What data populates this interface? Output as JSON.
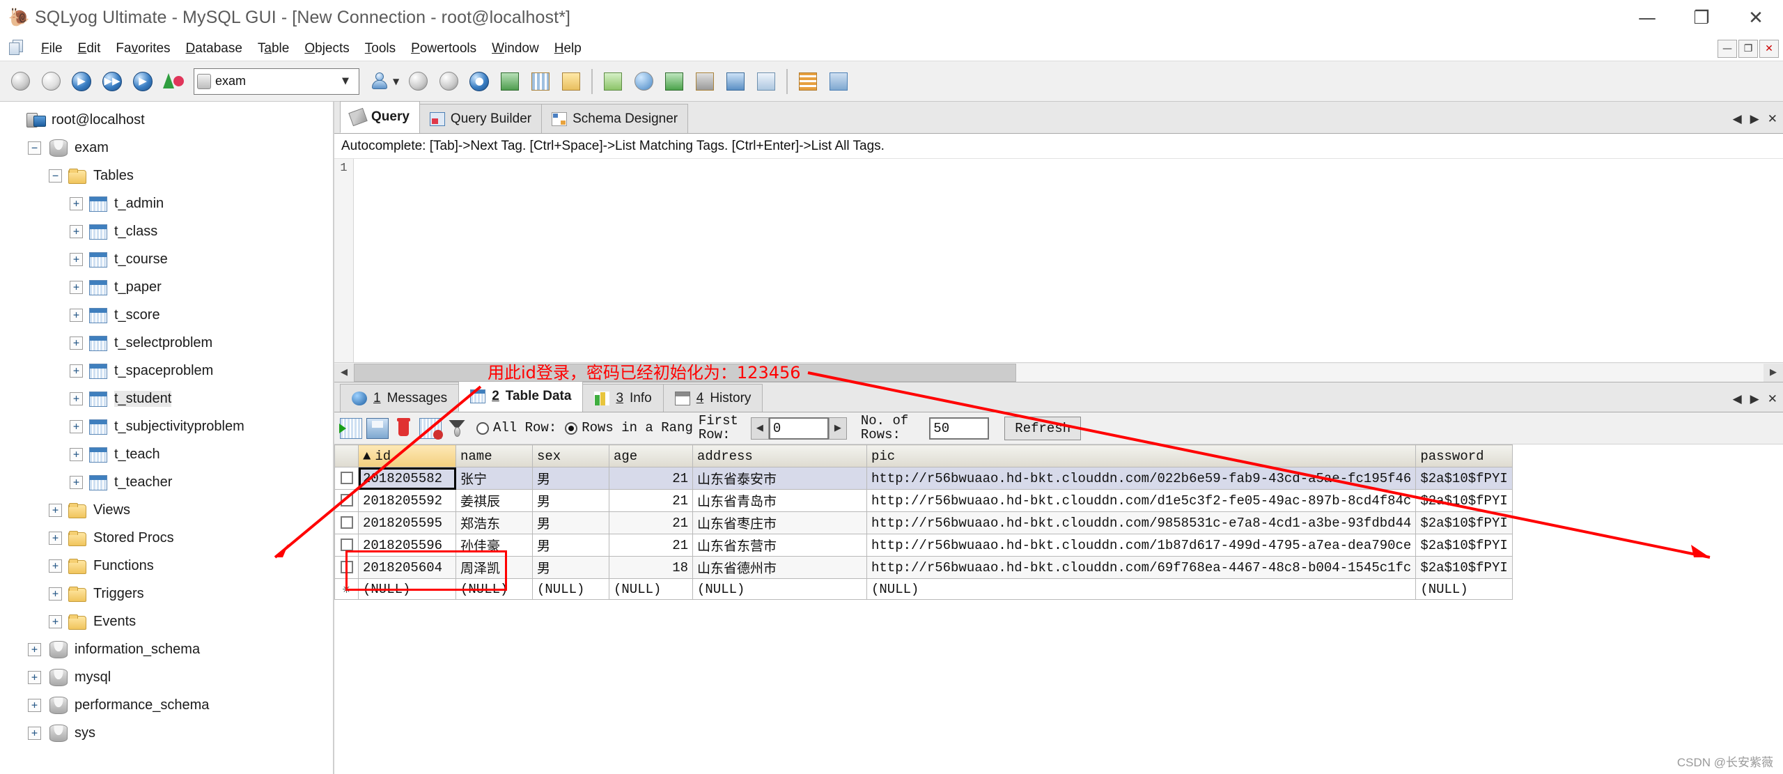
{
  "window": {
    "title": "SQLyog Ultimate - MySQL GUI - [New Connection - root@localhost*]",
    "app_icon": "sqlyog-dolphin-icon",
    "minimize": "—",
    "maximize": "❐",
    "close": "✕",
    "mdi_minimize": "—",
    "mdi_restore": "❐",
    "mdi_close": "✕"
  },
  "menubar": {
    "items": [
      {
        "pre": "",
        "hot": "F",
        "post": "ile"
      },
      {
        "pre": "",
        "hot": "E",
        "post": "dit"
      },
      {
        "pre": "Fa",
        "hot": "v",
        "post": "orites"
      },
      {
        "pre": "",
        "hot": "D",
        "post": "atabase"
      },
      {
        "pre": "T",
        "hot": "a",
        "post": "ble"
      },
      {
        "pre": "",
        "hot": "O",
        "post": "bjects"
      },
      {
        "pre": "",
        "hot": "T",
        "post": "ools"
      },
      {
        "pre": "",
        "hot": "P",
        "post": "owertools"
      },
      {
        "pre": "",
        "hot": "W",
        "post": "indow"
      },
      {
        "pre": "",
        "hot": "H",
        "post": "elp"
      }
    ]
  },
  "toolbar": {
    "database_selected": "exam",
    "buttons": [
      "new-connection-icon",
      "edit-connection-icon",
      "execute-query-icon",
      "execute-all-queries-icon",
      "execute-current-query-icon",
      "favorites-icon",
      "user-manager-icon",
      "new-schema-icon",
      "refresh-schema-icon",
      "sql-format-icon",
      "table-diagnostics-icon",
      "grid-view-icon",
      "form-view-icon",
      "quick-filter-icon",
      "sync-data-icon",
      "data-import-icon",
      "backup-icon",
      "scheduler-icon",
      "notification-icon",
      "table-data-icon",
      "schema-sync-icon"
    ]
  },
  "sidebar": {
    "nodes": [
      {
        "label": "root@localhost",
        "indent": 0,
        "expander": "",
        "icon": "server-icon",
        "selected": false
      },
      {
        "label": "exam",
        "indent": 1,
        "expander": "−",
        "icon": "database-icon",
        "selected": false
      },
      {
        "label": "Tables",
        "indent": 2,
        "expander": "−",
        "icon": "folder-icon",
        "selected": false
      },
      {
        "label": "t_admin",
        "indent": 3,
        "expander": "+",
        "icon": "table-icon",
        "selected": false
      },
      {
        "label": "t_class",
        "indent": 3,
        "expander": "+",
        "icon": "table-icon",
        "selected": false
      },
      {
        "label": "t_course",
        "indent": 3,
        "expander": "+",
        "icon": "table-icon",
        "selected": false
      },
      {
        "label": "t_paper",
        "indent": 3,
        "expander": "+",
        "icon": "table-icon",
        "selected": false
      },
      {
        "label": "t_score",
        "indent": 3,
        "expander": "+",
        "icon": "table-icon",
        "selected": false
      },
      {
        "label": "t_selectproblem",
        "indent": 3,
        "expander": "+",
        "icon": "table-icon",
        "selected": false
      },
      {
        "label": "t_spaceproblem",
        "indent": 3,
        "expander": "+",
        "icon": "table-icon",
        "selected": false
      },
      {
        "label": "t_student",
        "indent": 3,
        "expander": "+",
        "icon": "table-icon",
        "selected": true
      },
      {
        "label": "t_subjectivityproblem",
        "indent": 3,
        "expander": "+",
        "icon": "table-icon",
        "selected": false
      },
      {
        "label": "t_teach",
        "indent": 3,
        "expander": "+",
        "icon": "table-icon",
        "selected": false
      },
      {
        "label": "t_teacher",
        "indent": 3,
        "expander": "+",
        "icon": "table-icon",
        "selected": false
      },
      {
        "label": "Views",
        "indent": 2,
        "expander": "+",
        "icon": "folder-icon",
        "selected": false
      },
      {
        "label": "Stored Procs",
        "indent": 2,
        "expander": "+",
        "icon": "folder-icon",
        "selected": false
      },
      {
        "label": "Functions",
        "indent": 2,
        "expander": "+",
        "icon": "folder-icon",
        "selected": false
      },
      {
        "label": "Triggers",
        "indent": 2,
        "expander": "+",
        "icon": "folder-icon",
        "selected": false
      },
      {
        "label": "Events",
        "indent": 2,
        "expander": "+",
        "icon": "folder-icon",
        "selected": false
      },
      {
        "label": "information_schema",
        "indent": 1,
        "expander": "+",
        "icon": "database-icon",
        "selected": false
      },
      {
        "label": "mysql",
        "indent": 1,
        "expander": "+",
        "icon": "database-icon",
        "selected": false
      },
      {
        "label": "performance_schema",
        "indent": 1,
        "expander": "+",
        "icon": "database-icon",
        "selected": false
      },
      {
        "label": "sys",
        "indent": 1,
        "expander": "+",
        "icon": "database-icon",
        "selected": false
      }
    ]
  },
  "editor_tabs": {
    "tabs": [
      {
        "label": "Query",
        "icon": "query-pencil-icon",
        "active": true
      },
      {
        "label": "Query Builder",
        "icon": "query-builder-icon",
        "active": false
      },
      {
        "label": "Schema Designer",
        "icon": "schema-designer-icon",
        "active": false
      }
    ],
    "nav_prev": "◀",
    "nav_next": "▶",
    "close": "✕"
  },
  "autocomplete_hint": "Autocomplete: [Tab]->Next Tag. [Ctrl+Space]->List Matching Tags. [Ctrl+Enter]->List All Tags.",
  "editor": {
    "line_number": "1",
    "content": "",
    "scroll_left_arrow": "◀",
    "scroll_right_arrow": "▶"
  },
  "result_tabs": {
    "tabs": [
      {
        "num": "1",
        "label": "Messages",
        "icon": "info-badge-icon",
        "active": false
      },
      {
        "num": "2",
        "label": "Table Data",
        "icon": "grid-icon",
        "active": true
      },
      {
        "num": "3",
        "label": "Info",
        "icon": "chart-icon",
        "active": false
      },
      {
        "num": "4",
        "label": "History",
        "icon": "calendar-icon",
        "active": false
      }
    ],
    "nav_prev": "◀",
    "nav_next": "▶",
    "close": "✕"
  },
  "grid_toolbar": {
    "icons": [
      "add-new-row-icon",
      "save-changes-icon",
      "delete-row-icon",
      "refresh-data-icon",
      "filter-icon"
    ],
    "radio_all_rows": "All Row:",
    "radio_rows_in_range": "Rows in a Rang",
    "radio_selected": "rows_in_range",
    "first_row_label_line1": "First",
    "first_row_label_line2": "Row:",
    "first_row_value": "0",
    "spin_prev": "◀",
    "spin_next": "▶",
    "no_of_rows_label_line1": "No. of",
    "no_of_rows_label_line2": "Rows:",
    "no_of_rows_value": "50",
    "refresh_button": "Refresh"
  },
  "data_grid": {
    "sort_indicator": "▲",
    "sorted_column": "id",
    "columns": [
      "id",
      "name",
      "sex",
      "age",
      "address",
      "pic",
      "password"
    ],
    "rows": [
      {
        "id": "2018205582",
        "name": "张宁",
        "sex": "男",
        "age": "21",
        "address": "山东省泰安市",
        "pic": "http://r56bwuaao.hd-bkt.clouddn.com/022b6e59-fab9-43cd-a5ae-fc195f46",
        "password": "$2a$10$fPYI"
      },
      {
        "id": "2018205592",
        "name": "姜祺辰",
        "sex": "男",
        "age": "21",
        "address": "山东省青岛市",
        "pic": "http://r56bwuaao.hd-bkt.clouddn.com/d1e5c3f2-fe05-49ac-897b-8cd4f84c",
        "password": "$2a$10$fPYI"
      },
      {
        "id": "2018205595",
        "name": "郑浩东",
        "sex": "男",
        "age": "21",
        "address": "山东省枣庄市",
        "pic": "http://r56bwuaao.hd-bkt.clouddn.com/9858531c-e7a8-4cd1-a3be-93fdbd44",
        "password": "$2a$10$fPYI"
      },
      {
        "id": "2018205596",
        "name": "孙佳豪",
        "sex": "男",
        "age": "21",
        "address": "山东省东营市",
        "pic": "http://r56bwuaao.hd-bkt.clouddn.com/1b87d617-499d-4795-a7ea-dea790ce",
        "password": "$2a$10$fPYI"
      },
      {
        "id": "2018205604",
        "name": "周泽凯",
        "sex": "男",
        "age": "18",
        "address": "山东省德州市",
        "pic": "http://r56bwuaao.hd-bkt.clouddn.com/69f768ea-4467-48c8-b004-1545c1fc",
        "password": "$2a$10$fPYI"
      }
    ],
    "new_row": {
      "marker": "✳",
      "id": "(NULL)",
      "name": "(NULL)",
      "sex": "(NULL)",
      "age": "(NULL)",
      "address": "(NULL)",
      "pic": "(NULL)",
      "password": "(NULL)"
    }
  },
  "annotations": {
    "note_text": "用此id登录，密码已经初始化为：123456",
    "highlight_color": "#ff0000"
  },
  "watermark": "CSDN @长安紫薇"
}
